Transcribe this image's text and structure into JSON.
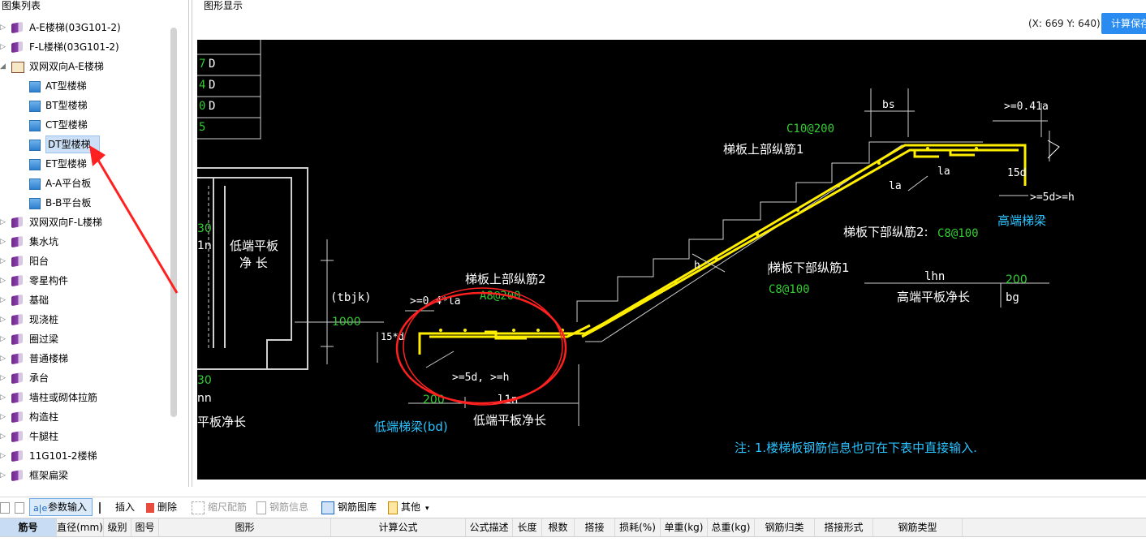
{
  "left_panel": {
    "title": "图集列表",
    "items": [
      {
        "label": "A-E楼梯(03G101-2)",
        "icon": "book-icon"
      },
      {
        "label": "F-L楼梯(03G101-2)",
        "icon": "book-icon"
      },
      {
        "label": "双网双向A-E楼梯",
        "icon": "open-book-icon",
        "expanded": true
      },
      {
        "label": "AT型楼梯",
        "icon": "doc-icon",
        "child": true
      },
      {
        "label": "BT型楼梯",
        "icon": "doc-icon",
        "child": true
      },
      {
        "label": "CT型楼梯",
        "icon": "doc-icon",
        "child": true
      },
      {
        "label": "DT型楼梯",
        "icon": "doc-icon",
        "child": true,
        "selected": true
      },
      {
        "label": "ET型楼梯",
        "icon": "doc-icon",
        "child": true
      },
      {
        "label": "A-A平台板",
        "icon": "doc-icon",
        "child": true
      },
      {
        "label": "B-B平台板",
        "icon": "doc-icon",
        "child": true
      },
      {
        "label": "双网双向F-L楼梯",
        "icon": "book-icon"
      },
      {
        "label": "集水坑",
        "icon": "book-icon"
      },
      {
        "label": "阳台",
        "icon": "book-icon"
      },
      {
        "label": "零星构件",
        "icon": "book-icon"
      },
      {
        "label": "基础",
        "icon": "book-icon"
      },
      {
        "label": "现浇桩",
        "icon": "book-icon"
      },
      {
        "label": "圈过梁",
        "icon": "book-icon"
      },
      {
        "label": "普通楼梯",
        "icon": "book-icon"
      },
      {
        "label": "承台",
        "icon": "book-icon"
      },
      {
        "label": "墙柱或砌体拉筋",
        "icon": "book-icon"
      },
      {
        "label": "构造柱",
        "icon": "book-icon"
      },
      {
        "label": "牛腿柱",
        "icon": "book-icon"
      },
      {
        "label": "11G101-2楼梯",
        "icon": "book-icon"
      },
      {
        "label": "框架扁梁",
        "icon": "book-icon"
      }
    ]
  },
  "right_panel": {
    "title": "图形显示",
    "coords": "(X: 669 Y: 640)",
    "calc_button": "计算保存"
  },
  "drawing": {
    "table_rows": [
      "7 D",
      "4 D",
      "0 D",
      "5"
    ],
    "left_labels": {
      "n1": "30",
      "n2": "1n",
      "low_plate": "低端平板",
      "net_len": "净  长",
      "n3": "30",
      "n4": "nn",
      "plate_net": "平板净长"
    },
    "tbjk": "(tbjk)",
    "v1000": "1000",
    "d15": "15*d",
    "la04": ">=0.4*la",
    "top_bar2": "梯板上部纵筋2",
    "a8": "A8@200",
    "d5h": ">=5d, >=h",
    "v200_low": "200",
    "l1n": "l1n",
    "low_beam": "低端梯梁(bd)",
    "low_net": "低端平板净长",
    "h": "h",
    "bs": "bs",
    "c10": "C10@200",
    "top_bar1": "梯板上部纵筋1",
    "la_a": "la",
    "la_b": "la",
    "la041": ">=0.41a",
    "d15b": "15d",
    "d5h2": ">=5d>=h",
    "high_beam": "高端梯梁",
    "bot_bar2": "梯板下部纵筋2:",
    "c8_2": "C8@100",
    "bot_bar1": "梯板下部纵筋1",
    "c8_1": "C8@100",
    "lhn": "lhn",
    "v200_high": "200",
    "high_net": "高端平板净长",
    "bg": "bg",
    "note": "注: 1.楼梯板钢筋信息也可在下表中直接输入."
  },
  "toolbar": {
    "items": [
      {
        "label": "参数输入",
        "state": "active"
      },
      {
        "label": "插入",
        "state": "enabled"
      },
      {
        "label": "删除",
        "state": "enabled"
      },
      {
        "label": "缩尺配筋",
        "state": "disabled"
      },
      {
        "label": "钢筋信息",
        "state": "disabled"
      },
      {
        "label": "钢筋图库",
        "state": "enabled"
      },
      {
        "label": "其他",
        "state": "enabled"
      }
    ]
  },
  "grid": {
    "headers": [
      "筋号",
      "直径(mm)",
      "级别",
      "图号",
      "图形",
      "计算公式",
      "公式描述",
      "长度",
      "根数",
      "搭接",
      "损耗(%)",
      "单重(kg)",
      "总重(kg)",
      "钢筋归类",
      "搭接形式",
      "钢筋类型"
    ]
  }
}
